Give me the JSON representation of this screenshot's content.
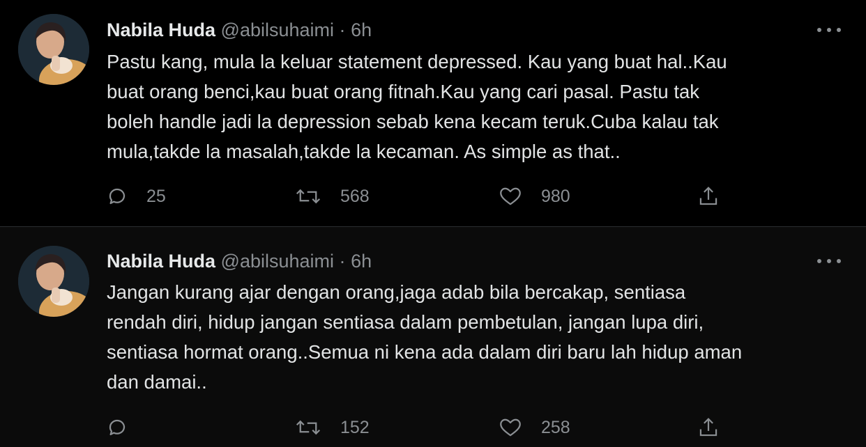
{
  "tweets": [
    {
      "author_name": "Nabila Huda",
      "handle": "@abilsuhaimi",
      "separator": "·",
      "time": "6h",
      "text": "Pastu kang, mula la keluar statement depressed. Kau yang buat hal..Kau\nbuat orang benci,kau buat orang fitnah.Kau yang cari pasal. Pastu tak\nboleh handle jadi la depression sebab kena kecam teruk.Cuba kalau tak\nmula,takde la masalah,takde la kecaman. As simple as that..",
      "replies": "25",
      "retweets": "568",
      "likes": "980"
    },
    {
      "author_name": "Nabila Huda",
      "handle": "@abilsuhaimi",
      "separator": "·",
      "time": "6h",
      "text": "Jangan kurang ajar dengan orang,jaga adab bila bercakap, sentiasa\nrendah diri, hidup jangan sentiasa dalam pembetulan, jangan lupa diri,\nsentiasa hormat orang..Semua ni kena ada dalam diri baru lah hidup aman\ndan damai..",
      "replies": "",
      "retweets": "152",
      "likes": "258"
    }
  ],
  "icons": {
    "reply": "speech-bubble-icon",
    "retweet": "retweet-arrows-icon",
    "like": "heart-icon",
    "share": "share-upload-icon",
    "more": "more-dots-icon"
  },
  "colors": {
    "background": "#000000",
    "text_primary": "#e7e9ea",
    "text_secondary": "#8b8f93",
    "divider": "#2a2d30"
  }
}
